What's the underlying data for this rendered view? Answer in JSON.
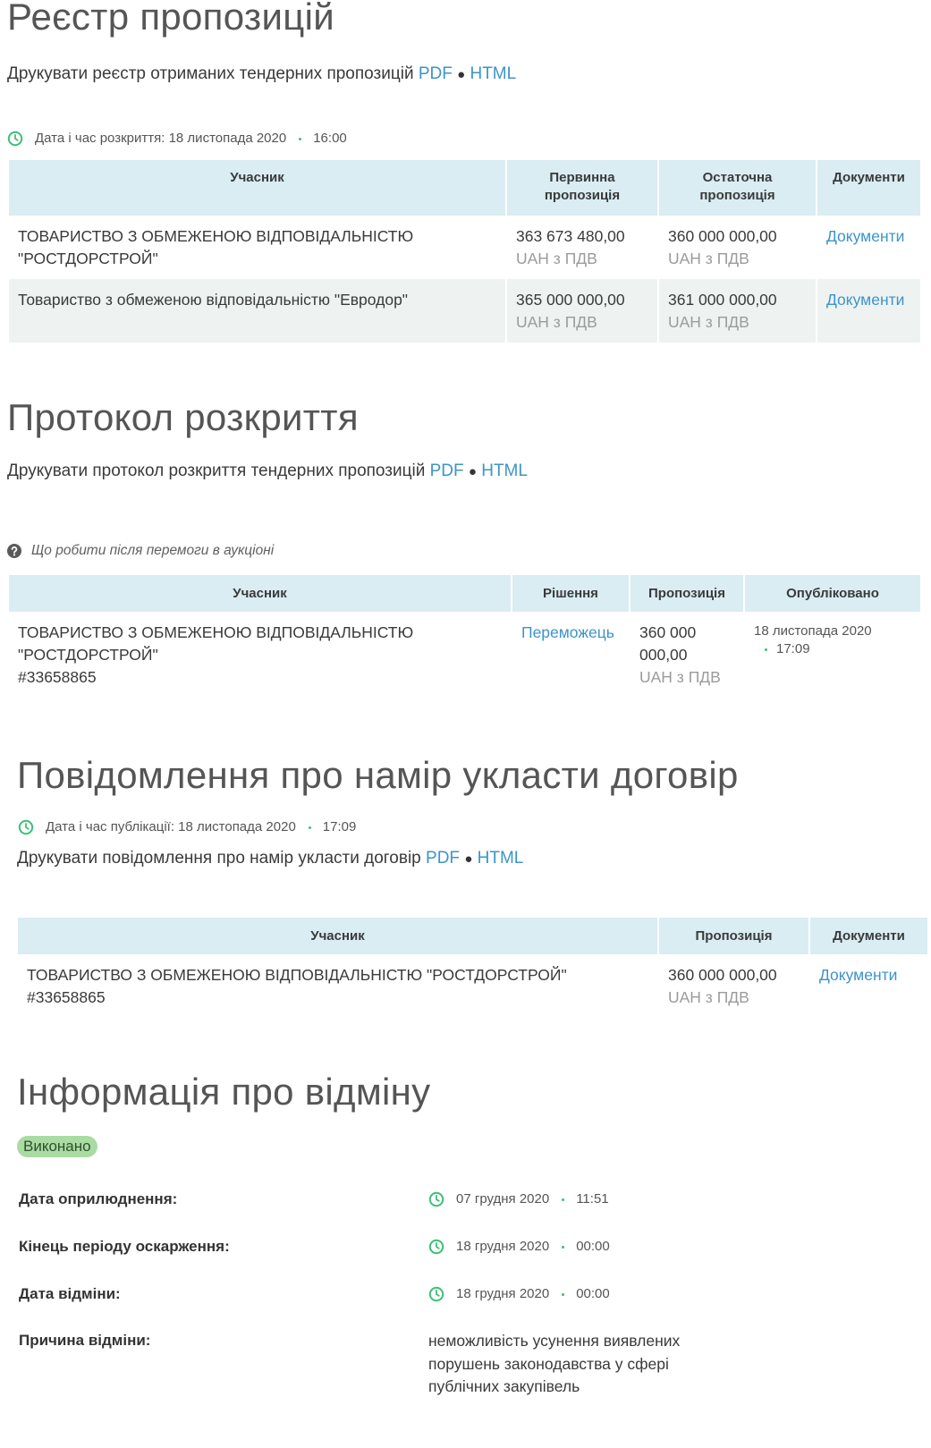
{
  "registry": {
    "title": "Реєстр пропозицій",
    "print_label": "Друкувати реєстр отриманих тендерних пропозицій",
    "pdf_link": "PDF",
    "separator": "●",
    "html_link": "HTML",
    "opening_date": "Дата і час розкриття: 18 листопада 2020",
    "opening_time": "16:00",
    "columns": {
      "participant": "Учасник",
      "initial": "Первинна пропозиція",
      "final": "Остаточна пропозиція",
      "documents": "Документи"
    },
    "rows": [
      {
        "participant": "ТОВАРИСТВО З ОБМЕЖЕНОЮ ВІДПОВІДАЛЬНІСТЮ \"РОСТДОРСТРОЙ\"",
        "initial_amount": "363 673 480,00",
        "initial_currency": "UAH з ПДВ",
        "final_amount": "360 000 000,00",
        "final_currency": "UAH з ПДВ",
        "documents": "Документи"
      },
      {
        "participant": "Товариство з обмеженою відповідальністю \"Евродор\"",
        "initial_amount": "365 000 000,00",
        "initial_currency": "UAH з ПДВ",
        "final_amount": "361 000 000,00",
        "final_currency": "UAH з ПДВ",
        "documents": "Документи"
      }
    ]
  },
  "protocol": {
    "title": "Протокол розкриття",
    "print_label": "Друкувати протокол розкриття тендерних пропозицій",
    "pdf_link": "PDF",
    "separator": "●",
    "html_link": "HTML",
    "help_link": "Що робити після перемоги в аукціоні",
    "columns": {
      "participant": "Учасник",
      "decision": "Рішення",
      "offer": "Пропозиція",
      "published": "Опубліковано"
    },
    "rows": [
      {
        "participant": "ТОВАРИСТВО З ОБМЕЖЕНОЮ ВІДПОВІДАЛЬНІСТЮ \"РОСТДОРСТРОЙ\"",
        "code": "#33658865",
        "decision": "Переможець",
        "amount": "360 000 000,00",
        "currency": "UAH з ПДВ",
        "published_date": "18 листопада 2020",
        "published_time": "17:09"
      }
    ]
  },
  "intent": {
    "title": "Повідомлення про намір укласти договір",
    "published_date": "Дата і час публікації: 18 листопада 2020",
    "published_time": "17:09",
    "print_label": "Друкувати повідомлення про намір укласти договір",
    "pdf_link": "PDF",
    "separator": "●",
    "html_link": "HTML",
    "columns": {
      "participant": "Учасник",
      "offer": "Пропозиція",
      "documents": "Документи"
    },
    "rows": [
      {
        "participant": "ТОВАРИСТВО З ОБМЕЖЕНОЮ ВІДПОВІДАЛЬНІСТЮ \"РОСТДОРСТРОЙ\"",
        "code": "#33658865",
        "amount": "360 000 000,00",
        "currency": "UAH з ПДВ",
        "documents": "Документи"
      }
    ]
  },
  "cancellation": {
    "title": "Інформація про відміну",
    "status": "Виконано",
    "fields": [
      {
        "label": "Дата оприлюднення:",
        "date": "07 грудня 2020",
        "time": "11:51"
      },
      {
        "label": "Кінець періоду оскарження:",
        "date": "18 грудня 2020",
        "time": "00:00"
      },
      {
        "label": "Дата відміни:",
        "date": "18 грудня 2020",
        "time": "00:00"
      }
    ],
    "reason_label": "Причина відміни:",
    "reason": "неможливість усунення виявлених порушень законодавства у сфері публічних закупівель"
  },
  "icons": {
    "clock": "clock-icon",
    "help": "question-circle-icon"
  },
  "colors": {
    "link": "#3d94c9",
    "table_header_bg": "#d9edf3",
    "alt_row_bg": "#eef3f2",
    "accent_green": "#3cbf74",
    "badge_bg": "#a9dba2",
    "muted_text": "#9b9b9b"
  }
}
